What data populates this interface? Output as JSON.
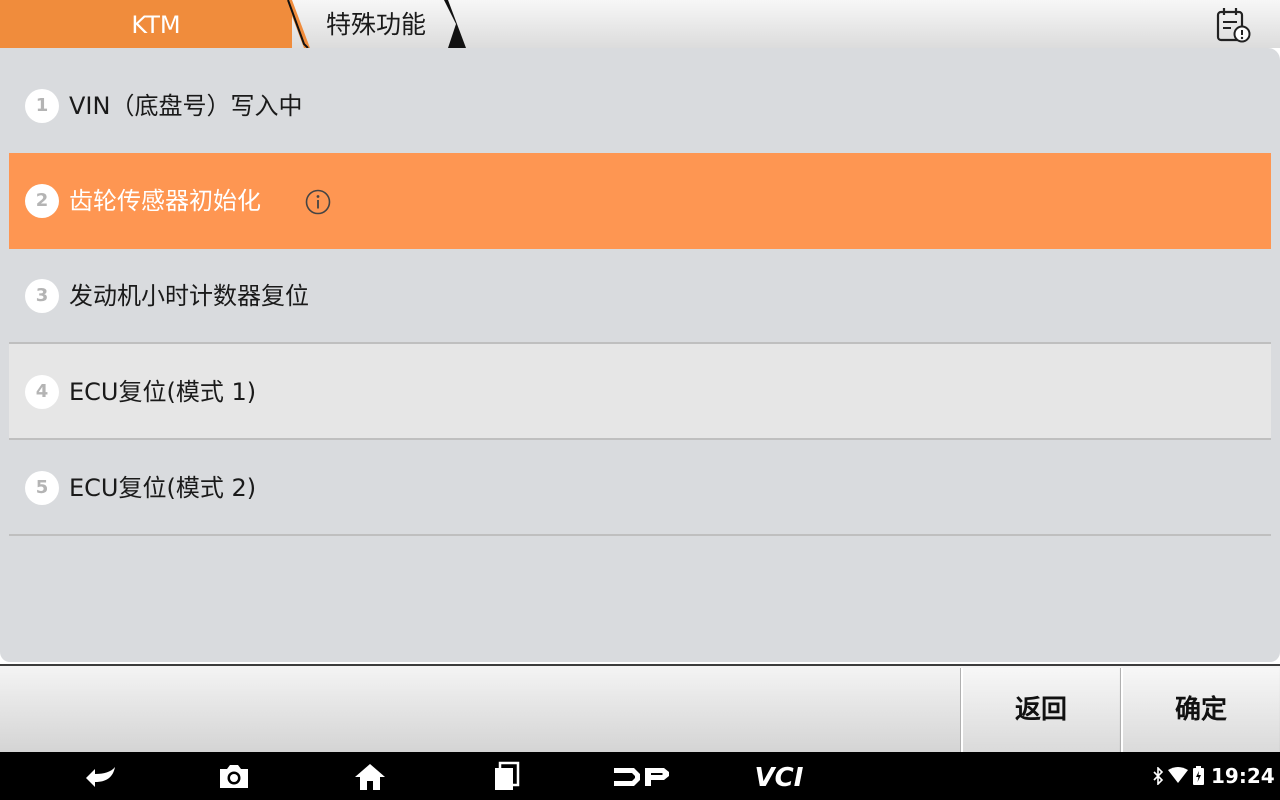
{
  "header": {
    "root_label": "KTM",
    "current_label": "特殊功能",
    "report_icon": "report-icon"
  },
  "menu": {
    "selected_index": 2,
    "items": [
      {
        "number": "1",
        "label": "VIN（底盘号）写入中"
      },
      {
        "number": "2",
        "label": "齿轮传感器初始化",
        "has_info": true
      },
      {
        "number": "3",
        "label": "发动机小时计数器复位"
      },
      {
        "number": "4",
        "label": "ECU复位(模式 1)"
      },
      {
        "number": "5",
        "label": "ECU复位(模式 2)"
      }
    ]
  },
  "actions": {
    "back_label": "返回",
    "confirm_label": "确定"
  },
  "navbar": {
    "icons": [
      "back-icon",
      "camera-icon",
      "home-icon",
      "recents-icon",
      "dp-logo-icon",
      "vci-logo-icon"
    ],
    "vci_label": "VCI",
    "time": "19:24"
  },
  "colors": {
    "accent": "#f08c3c",
    "selected_row": "#fe9652",
    "panel_bg": "#d9dbde"
  }
}
